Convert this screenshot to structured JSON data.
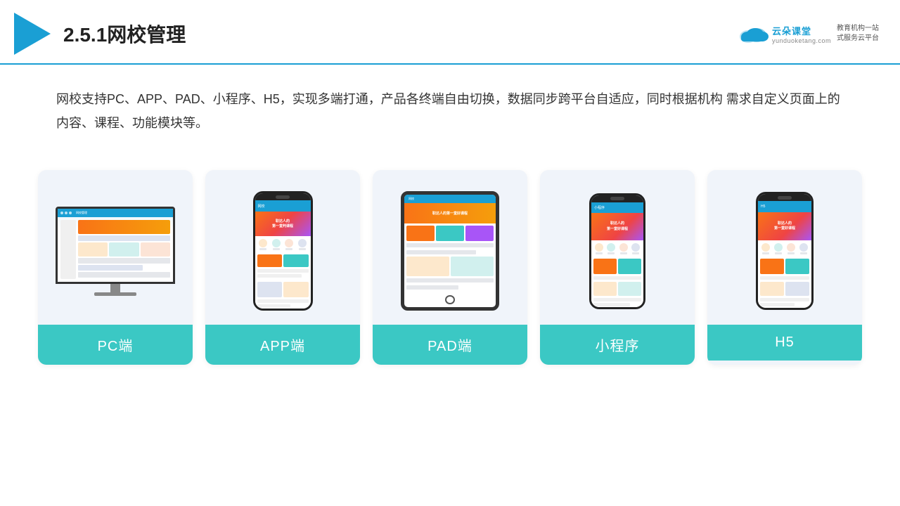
{
  "header": {
    "title": "2.5.1网校管理",
    "brand": {
      "name": "云朵课堂",
      "url": "yunduoketang.com",
      "tagline": "教育机构一站\n式服务云平台"
    }
  },
  "description": "网校支持PC、APP、PAD、小程序、H5，实现多端打通，产品各终端自由切换，数据同步跨平台自适应，同时根据机构\n需求自定义页面上的内容、课程、功能模块等。",
  "cards": [
    {
      "id": "pc",
      "label": "PC端"
    },
    {
      "id": "app",
      "label": "APP端"
    },
    {
      "id": "pad",
      "label": "PAD端"
    },
    {
      "id": "miniapp",
      "label": "小程序"
    },
    {
      "id": "h5",
      "label": "H5"
    }
  ],
  "colors": {
    "primary": "#1a9fd4",
    "teal": "#3bc8c4",
    "orange": "#f97316"
  }
}
